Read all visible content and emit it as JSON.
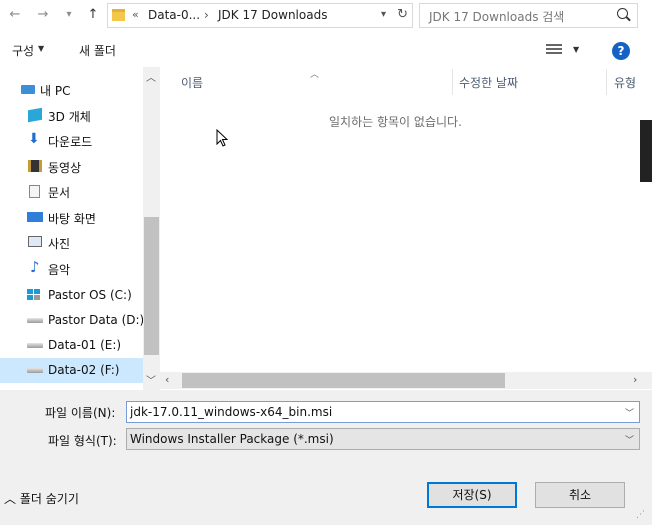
{
  "address": {
    "back_icon": "arrow-left-icon",
    "forward_icon": "arrow-right-icon",
    "recent_icon": "chevron-down-icon",
    "up_icon": "arrow-up-icon",
    "breadcrumb_overflow": "«",
    "breadcrumb": [
      "Data-0...",
      "JDK 17 Downloads"
    ],
    "separator": "›",
    "search_placeholder": "JDK 17 Downloads 검색"
  },
  "toolbar": {
    "organize_label": "구성",
    "new_folder_label": "새 폴더",
    "help_label": "?"
  },
  "nav": {
    "items": [
      {
        "label": "내 PC",
        "icon": "pc-icon"
      },
      {
        "label": "3D 개체",
        "icon": "3d-objects-icon"
      },
      {
        "label": "다운로드",
        "icon": "download-icon"
      },
      {
        "label": "동영상",
        "icon": "video-icon"
      },
      {
        "label": "문서",
        "icon": "document-icon"
      },
      {
        "label": "바탕 화면",
        "icon": "desktop-icon"
      },
      {
        "label": "사진",
        "icon": "pictures-icon"
      },
      {
        "label": "음악",
        "icon": "music-icon"
      },
      {
        "label": "Pastor OS (C:)",
        "icon": "windows-drive-icon"
      },
      {
        "label": "Pastor Data (D:)",
        "icon": "drive-icon"
      },
      {
        "label": "Data-01 (E:)",
        "icon": "drive-icon"
      },
      {
        "label": "Data-02 (F:)",
        "icon": "drive-icon"
      }
    ],
    "selected": "Data-02 (F:)"
  },
  "content": {
    "columns": [
      "이름",
      "수정한 날짜",
      "유형"
    ],
    "empty_message": "일치하는 항목이 없습니다."
  },
  "bottom": {
    "file_name_label": "파일 이름(N):",
    "file_name_value": "jdk-17.0.11_windows-x64_bin.msi",
    "file_type_label": "파일 형식(T):",
    "file_type_value": "Windows Installer Package (*.msi)",
    "hide_folders_label": "폴더 숨기기",
    "save_label": "저장(S)",
    "cancel_label": "취소"
  },
  "colors": {
    "selected_bg": "#cce8ff",
    "accent": "#0078d7",
    "help_blue": "#1662c4"
  }
}
